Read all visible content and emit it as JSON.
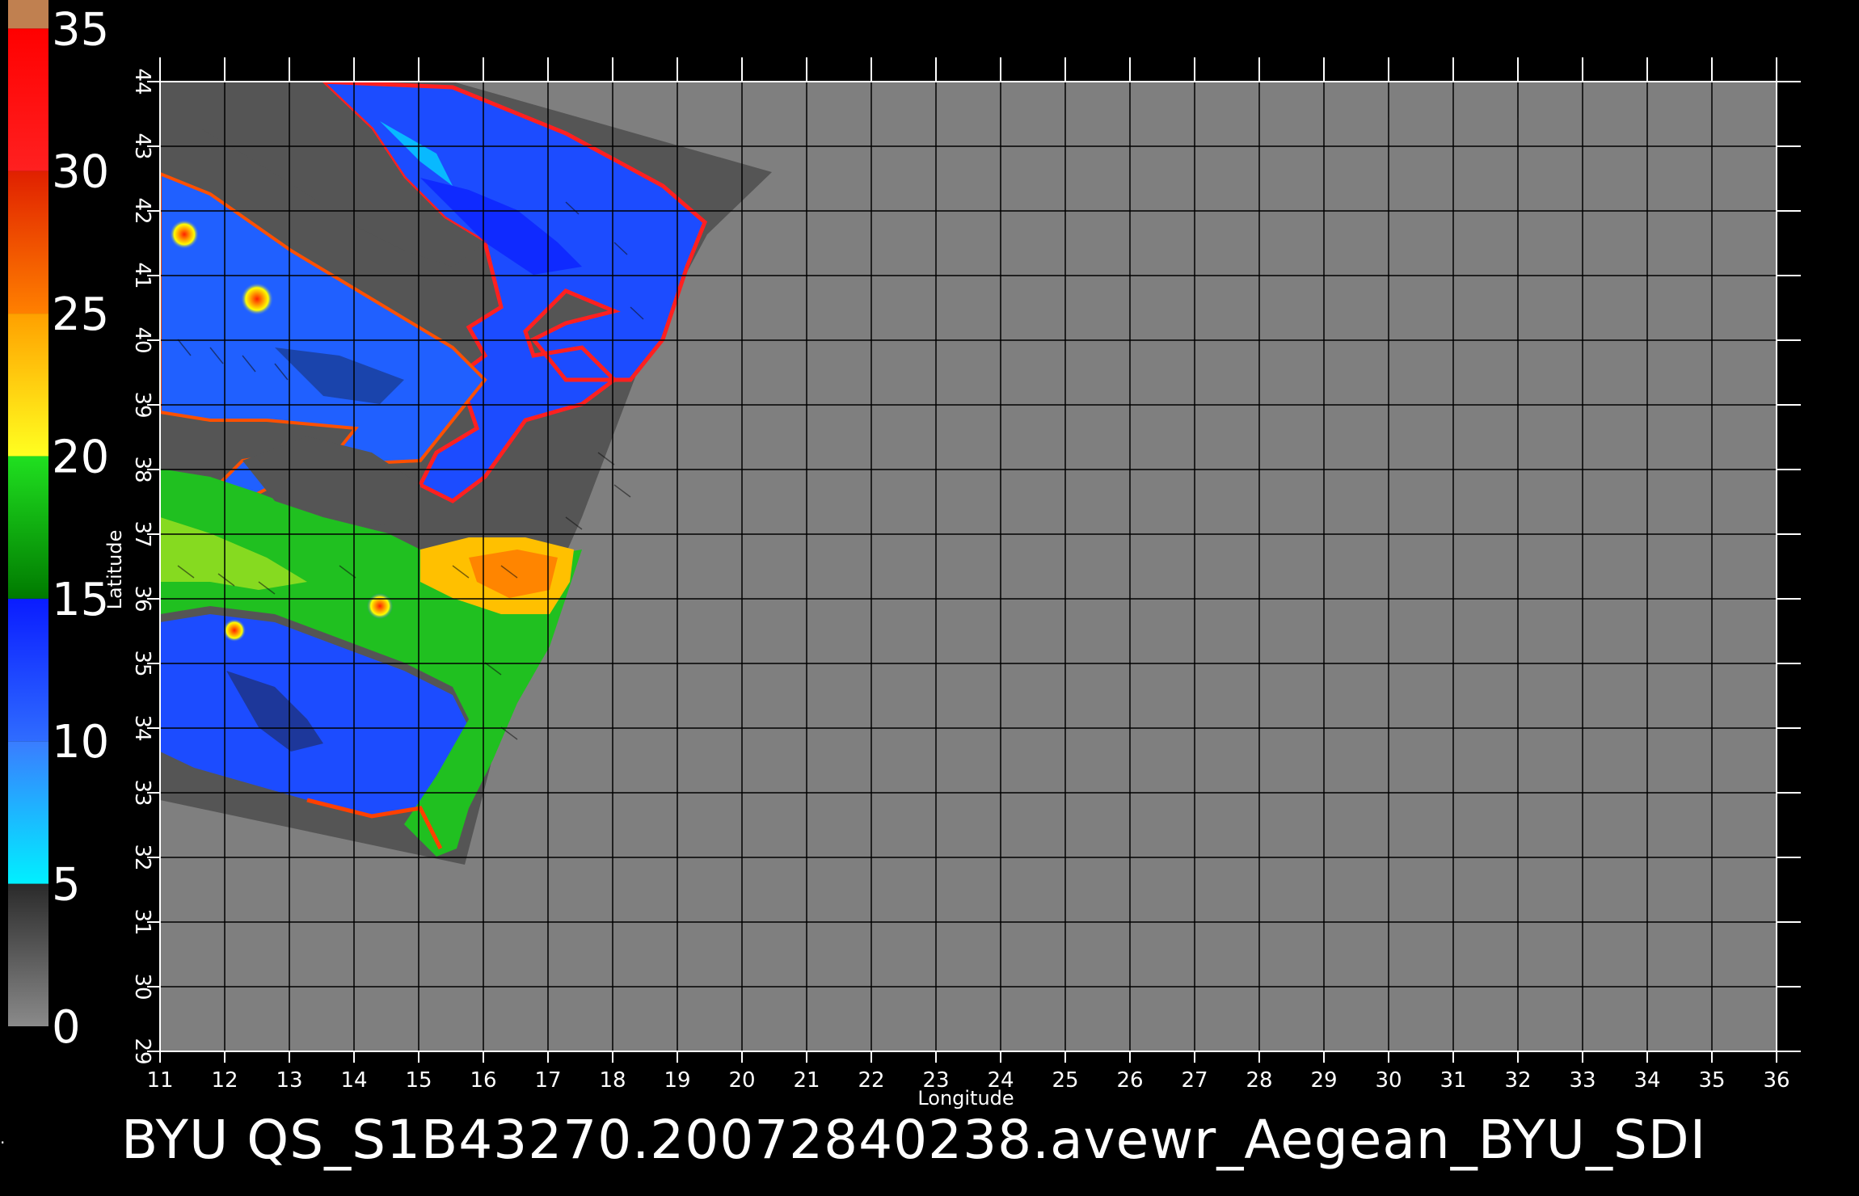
{
  "map": {
    "footer_text": "BYU  QS_S1B43270.20072840238.avewr_Aegean_BYU_SDI",
    "xlabel": "Longitude",
    "ylabel": "Latitude",
    "lon_range": [
      11,
      36
    ],
    "lat_range": [
      29,
      44
    ],
    "lon_ticks": [
      11,
      12,
      13,
      14,
      15,
      16,
      17,
      18,
      19,
      20,
      21,
      22,
      23,
      24,
      25,
      26,
      27,
      28,
      29,
      30,
      31,
      32,
      33,
      34,
      35,
      36
    ],
    "lat_ticks": [
      29,
      30,
      31,
      32,
      33,
      34,
      35,
      36,
      37,
      38,
      39,
      40,
      41,
      42,
      43,
      44
    ],
    "background_color": "#7f7f7f",
    "swath_color": "#555555"
  },
  "colorbar": {
    "labels": [
      "0",
      "5",
      "10",
      "15",
      "20",
      "25",
      "30",
      "35"
    ],
    "values": [
      0,
      5,
      10,
      15,
      20,
      25,
      30,
      35
    ],
    "bands": [
      {
        "from": 0,
        "to": 5,
        "colors": [
          "#8a8a8a",
          "#2a2a2a"
        ]
      },
      {
        "from": 5,
        "to": 10,
        "colors": [
          "#00f0ff",
          "#3a7cff"
        ]
      },
      {
        "from": 10,
        "to": 15,
        "colors": [
          "#2f6cff",
          "#0a1cff"
        ]
      },
      {
        "from": 15,
        "to": 20,
        "colors": [
          "#007a00",
          "#20e020"
        ]
      },
      {
        "from": 20,
        "to": 25,
        "colors": [
          "#ffff20",
          "#ffa000"
        ]
      },
      {
        "from": 25,
        "to": 30,
        "colors": [
          "#ff8000",
          "#e02000"
        ]
      },
      {
        "from": 30,
        "to": 35,
        "colors": [
          "#ff2020",
          "#ff0000"
        ]
      },
      {
        "from": 35,
        "to": 36,
        "colors": [
          "#c08050",
          "#c08050"
        ]
      }
    ]
  }
}
